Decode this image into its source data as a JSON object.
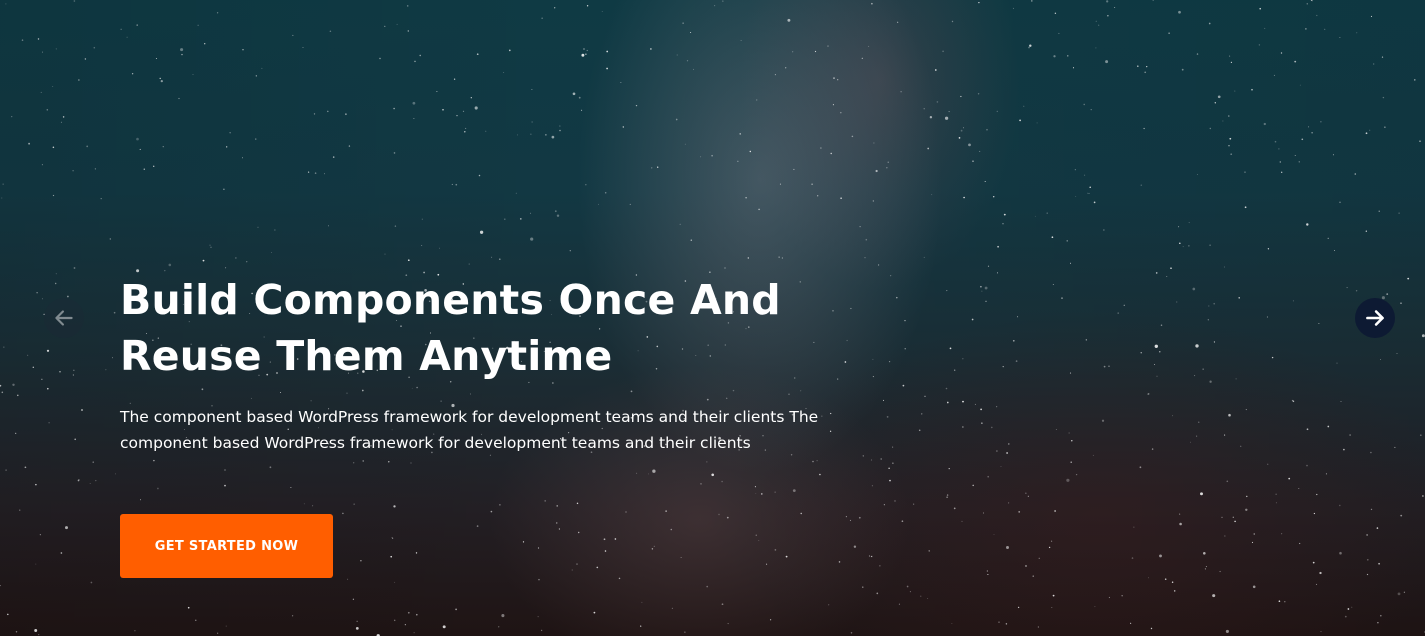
{
  "hero": {
    "title_line1": "Build Components Once And",
    "title_line2": "Reuse Them Anytime",
    "subtitle": "The component based WordPress framework for development teams and their clients The component based WordPress framework for development teams and their clients",
    "cta_label": "GET STARTED NOW"
  },
  "slider": {
    "prev_icon": "arrow-left-icon",
    "next_icon": "arrow-right-icon"
  },
  "colors": {
    "accent": "#ff5e00",
    "text": "#ffffff",
    "next_button_bg": "#0d1a33"
  }
}
